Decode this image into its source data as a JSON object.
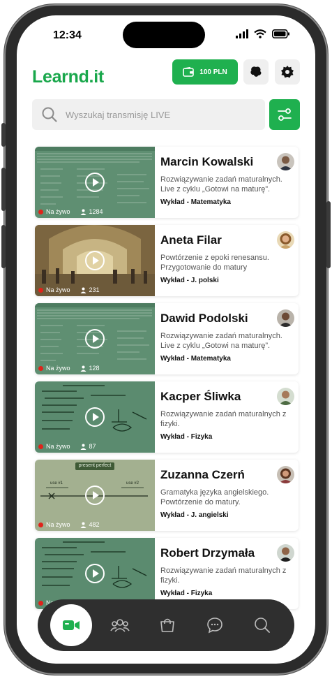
{
  "status_bar": {
    "time": "12:34"
  },
  "header": {
    "logo": "Learnd.it",
    "wallet_amount": "100 PLN"
  },
  "search": {
    "placeholder": "Wyszukaj transmisję LIVE"
  },
  "streams": [
    {
      "name": "Marcin Kowalski",
      "description": "Rozwiązywanie zadań maturalnych. Live z cyklu „Gotowi na maturę”.",
      "tag": "Wykład - Matematyka",
      "live": false,
      "status_label": "Na żywo",
      "viewers": "1284",
      "thumb": "doc"
    },
    {
      "name": "Aneta Filar",
      "description": "Powtórzenie z epoki renesansu. Przygotowanie do matury",
      "tag": "Wykład - J. polski",
      "live": true,
      "status_label": "Na żywo",
      "viewers": "231",
      "thumb": "art"
    },
    {
      "name": "Dawid Podolski",
      "description": "Rozwiązywanie zadań maturalnych. Live z cyklu „Gotowi na maturę”.",
      "tag": "Wykład - Matematyka",
      "live": false,
      "status_label": "Na żywo",
      "viewers": "128",
      "thumb": "doc"
    },
    {
      "name": "Kacper Śliwka",
      "description": "Rozwiązywanie zadań maturalnych z fizyki.",
      "tag": "Wykład - Fizyka",
      "live": true,
      "status_label": "Na żywo",
      "viewers": "87",
      "thumb": "board"
    },
    {
      "name": "Zuzanna Czerń",
      "description": "Gramatyka języka angielskiego. Powtórzenie do matury.",
      "tag": "Wykład - J. angielski",
      "live": false,
      "status_label": "Na żywo",
      "viewers": "482",
      "thumb": "present",
      "board_title": "present perfect",
      "board_label_1": "use #1",
      "board_label_2": "use #2"
    },
    {
      "name": "Robert Drzymała",
      "description": "Rozwiązywanie zadań maturalnych z fizyki.",
      "tag": "Wykład - Fizyka",
      "live": true,
      "status_label": "Na żywo",
      "viewers": "",
      "thumb": "board"
    }
  ],
  "bottom_nav": [
    {
      "icon": "video-camera-icon",
      "active": true
    },
    {
      "icon": "people-icon",
      "active": false
    },
    {
      "icon": "shopping-bag-icon",
      "active": false
    },
    {
      "icon": "chat-bubble-icon",
      "active": false
    },
    {
      "icon": "search-icon",
      "active": false
    }
  ],
  "colors": {
    "brand": "#1fb04f",
    "live": "#e0231a",
    "nav_bg": "#2f2f2f"
  }
}
